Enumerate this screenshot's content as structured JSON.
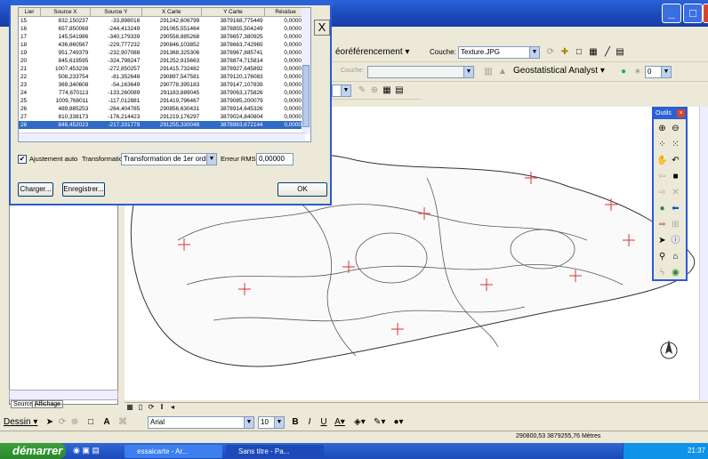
{
  "georef_dialog": {
    "columns": [
      "Lier",
      "Source X",
      "Source Y",
      "X Carte",
      "Y Carte",
      "Résidue"
    ],
    "rows": [
      [
        "15",
        "832,150237",
        "-33,898016",
        "291242,606799",
        "3879168,775449",
        "0,00000"
      ],
      [
        "16",
        "657,850068",
        "-244,413249",
        "291065,551464",
        "3878855,504249",
        "0,00000"
      ],
      [
        "17",
        "145,541986",
        "-340,179339",
        "290558,885268",
        "3878657,380925",
        "0,00000"
      ],
      [
        "18",
        "436,860567",
        "-229,777232",
        "290846,103852",
        "3878663,742965",
        "0,00000"
      ],
      [
        "19",
        "951,749379",
        "-232,907088",
        "291368,325306",
        "3878967,885741",
        "0,00000"
      ],
      [
        "20",
        "845,619595",
        "-324,798247",
        "291252,915663",
        "3878874,715814",
        "0,00000"
      ],
      [
        "21",
        "1007,453236",
        "-272,850257",
        "291415,732482",
        "3878927,645892",
        "0,00000"
      ],
      [
        "22",
        "508,233754",
        "-81,352648",
        "290897,547581",
        "3879120,176083",
        "0,00000"
      ],
      [
        "23",
        "369,340608",
        "-54,163649",
        "290778,395183",
        "3879147,107839",
        "0,00000"
      ],
      [
        "24",
        "774,670113",
        "-133,260089",
        "291183,889045",
        "3879063,175826",
        "0,00000"
      ],
      [
        "25",
        "1009,768011",
        "-117,012881",
        "291419,796467",
        "3879085,200079",
        "0,00000"
      ],
      [
        "26",
        "489,885253",
        "-264,404785",
        "290856,630431",
        "3878914,645326",
        "0,00000"
      ],
      [
        "27",
        "810,338173",
        "-176,214423",
        "291219,176297",
        "3879024,840804",
        "0,00000"
      ],
      [
        "28",
        "848,452023",
        "-217,331779",
        "291255,330048",
        "3878983,672144",
        "0,00000"
      ]
    ],
    "auto_adjust_label": "Ajustement auto",
    "transformation_label": "Transformation:",
    "transformation_value": "Transformation de 1er ordre",
    "rms_label": "Erreur RMS:",
    "rms_value": "0,00000",
    "load_label": "Charger...",
    "save_label": "Enregistrer...",
    "ok_label": "OK",
    "close_label": "X"
  },
  "toolbar": {
    "georef_menu": "éoréférencement ▾",
    "layer_label": "Couche:",
    "layer_value": "Texture.JPG",
    "layer2_label": "Couche:",
    "geostat_label": "Geostatistical Analyst ▾",
    "zoom_value": "0"
  },
  "tools_palette": {
    "title": "Outils"
  },
  "toc": {
    "tab_source": "Source",
    "tab_display": "Affichage"
  },
  "draw_toolbar": {
    "dessin_label": "Dessin ▾",
    "font_value": "Arial",
    "size_value": "10",
    "bold": "B",
    "italic": "I",
    "underline": "U"
  },
  "status": {
    "coords": "290800,53  3879255,76 Mètres"
  },
  "taskbar": {
    "start_label": "démarrer",
    "task1": "essaicarte - Ar...",
    "task2": "Sans titre - Pa...",
    "clock": "21:37"
  },
  "colors": {
    "title_blue": "#2a62d8",
    "selected_row": "#316ac5",
    "taskbar": "#2458c8",
    "start_green": "#3c9e3c"
  }
}
